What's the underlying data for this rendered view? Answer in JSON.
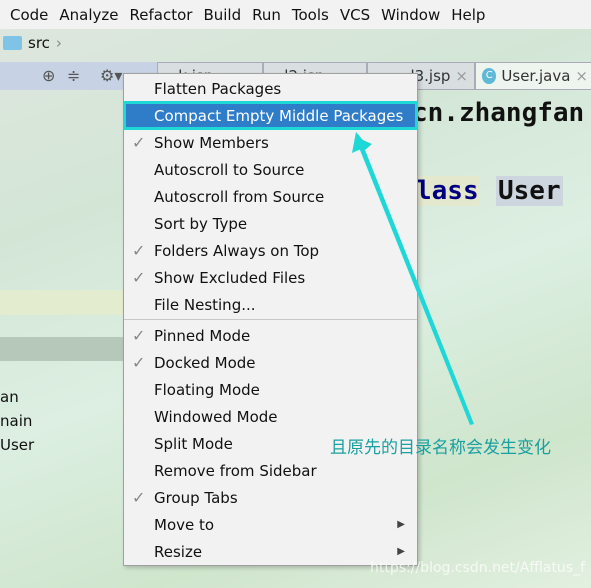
{
  "menubar": {
    "items": [
      "Code",
      "Analyze",
      "Refactor",
      "Build",
      "Run",
      "Tools",
      "VCS",
      "Window",
      "Help"
    ]
  },
  "breadcrumb": {
    "folder": "src"
  },
  "tabs": [
    {
      "label": "...k.jsp"
    },
    {
      "label": "...l2.jsp"
    },
    {
      "label": "l3.jsp"
    },
    {
      "label": "User.java",
      "icon": "C"
    }
  ],
  "code": {
    "line1": "cn.zhangfan",
    "line2_kw": "lass",
    "line2_name": "User"
  },
  "tree": [
    "an",
    "nain",
    "User"
  ],
  "context_menu": {
    "items": [
      {
        "label": "Flatten Packages",
        "checked": false
      },
      {
        "label": "Compact Empty Middle Packages",
        "checked": false,
        "highlighted": true
      },
      {
        "label": "Show Members",
        "checked": true
      },
      {
        "label": "Autoscroll to Source",
        "checked": false
      },
      {
        "label": "Autoscroll from Source",
        "checked": false
      },
      {
        "label": "Sort by Type",
        "checked": false
      },
      {
        "label": "Folders Always on Top",
        "checked": true
      },
      {
        "label": "Show Excluded Files",
        "checked": true
      },
      {
        "label": "File Nesting...",
        "checked": false
      },
      {
        "label": "Pinned Mode",
        "checked": true
      },
      {
        "label": "Docked Mode",
        "checked": true
      },
      {
        "label": "Floating Mode",
        "checked": false
      },
      {
        "label": "Windowed Mode",
        "checked": false
      },
      {
        "label": "Split Mode",
        "checked": false
      },
      {
        "label": "Remove from Sidebar",
        "checked": false
      },
      {
        "label": "Group Tabs",
        "checked": true
      },
      {
        "label": "Move to",
        "checked": false,
        "submenu": true
      },
      {
        "label": "Resize",
        "checked": false,
        "submenu": true
      }
    ]
  },
  "annotation": {
    "text": "且原先的目录名称会发生变化",
    "color": "#1ed8d8"
  },
  "watermark": "https://blog.csdn.net/Afflatus_f",
  "colors": {
    "highlight": "#2f7dc8",
    "annotation": "#1ed8d8"
  }
}
